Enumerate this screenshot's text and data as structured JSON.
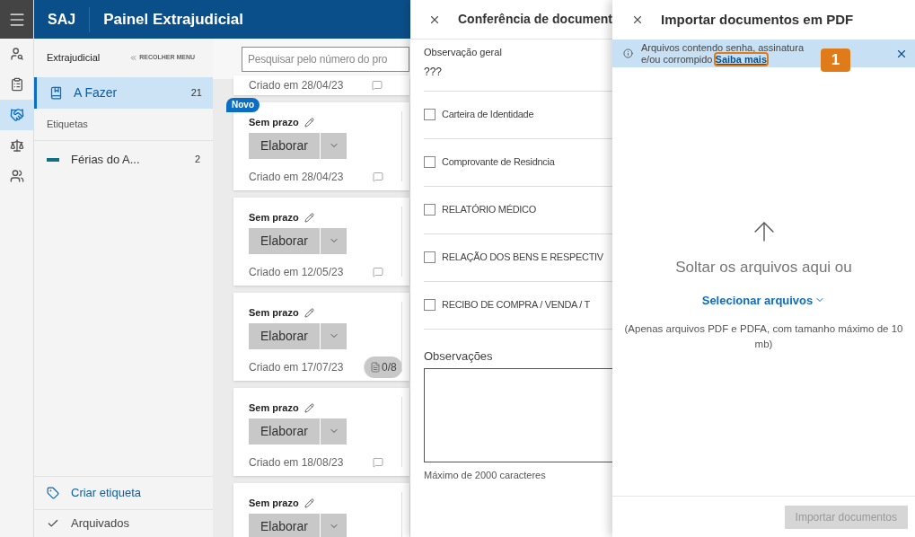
{
  "app": {
    "brand": "SAJ",
    "title": "Painel Extrajudicial"
  },
  "rail": [
    {
      "kind": "person",
      "selected": false
    },
    {
      "kind": "clipboard",
      "selected": false
    },
    {
      "kind": "handshake",
      "selected": true
    },
    {
      "kind": "scale",
      "selected": false
    },
    {
      "kind": "people",
      "selected": false
    }
  ],
  "sidebar": {
    "heading": "Extrajudicial",
    "collapse": "RECOLHER MENU",
    "items": [
      {
        "label": "A Fazer",
        "count": "21",
        "selected": true
      }
    ],
    "tags_heading": "Etiquetas",
    "tags": [
      {
        "label": "Férias do A...",
        "count": "2",
        "color": "#0e7080"
      }
    ],
    "create_tag": "Criar etiqueta",
    "archived": "Arquivados"
  },
  "search": {
    "placeholder": "Pesquisar pelo número do pro"
  },
  "cards": [
    {
      "kind": "partial",
      "created": "Criado em 28/04/23"
    },
    {
      "kind": "full",
      "badge": "Novo",
      "title": "Sem prazo",
      "action": "Elaborar",
      "created": "Criado em 28/04/23"
    },
    {
      "kind": "full",
      "title": "Sem prazo",
      "action": "Elaborar",
      "created": "Criado em 12/05/23"
    },
    {
      "kind": "full",
      "title": "Sem prazo",
      "action": "Elaborar",
      "created": "Criado em 17/07/23",
      "docs": "0/8"
    },
    {
      "kind": "full",
      "title": "Sem prazo",
      "action": "Elaborar",
      "created": "Criado em 18/08/23"
    },
    {
      "kind": "full",
      "title": "Sem prazo",
      "action": "Elaborar"
    }
  ],
  "review_panel": {
    "title": "Conferência de document",
    "general_label": "Observação geral",
    "general_value": "???",
    "documents": [
      {
        "label": "Carteira de Identidade",
        "checked": false
      },
      {
        "label": "Comprovante de Residncia",
        "checked": false
      },
      {
        "label": "RELATÓRIO MÉDICO",
        "checked": false
      },
      {
        "label": "RELAÇÃO DOS BENS E RESPECTIV",
        "checked": false
      },
      {
        "label": "RECIBO DE COMPRA / VENDA / T",
        "checked": false
      }
    ],
    "notes_label": "Observações",
    "notes_hint": "Máximo de 2000 caracteres"
  },
  "import_panel": {
    "title": "Importar documentos em PDF",
    "notice": "Arquivos contendo senha, assinatura e/ou corrompido",
    "notice_link": "Saiba mais",
    "callout": "1",
    "drop_text": "Soltar os arquivos aqui ou",
    "select": "Selecionar arquivos",
    "hint": "(Apenas arquivos PDF e PDFA, com tamanho máximo de 10 mb)",
    "submit": {
      "label": "Importar documentos",
      "disabled": true
    }
  }
}
